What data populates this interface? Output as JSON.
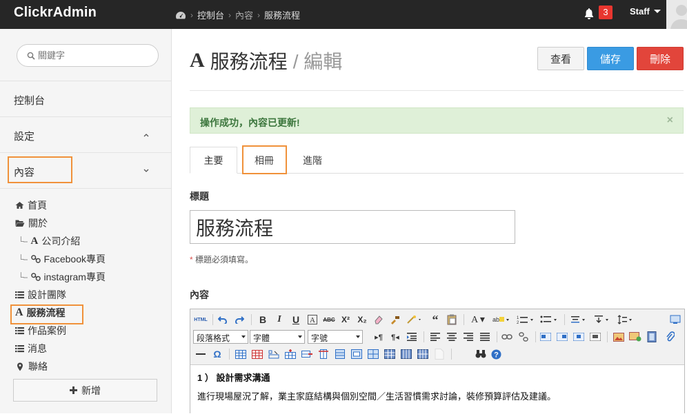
{
  "app": {
    "brand": "ClickrAdmin"
  },
  "breadcrumb": [
    "控制台",
    "內容",
    "服務流程"
  ],
  "topbar": {
    "notifications": "3",
    "user": "Staff"
  },
  "sidebar": {
    "search_placeholder": "關鍵字",
    "nav": [
      {
        "label": "控制台"
      },
      {
        "label": "設定"
      },
      {
        "label": "內容"
      }
    ],
    "tree": [
      {
        "label": "首頁",
        "icon": "home-icon"
      },
      {
        "label": "關於",
        "icon": "folder-open-icon"
      },
      {
        "label": "公司介紹",
        "icon": "font-icon"
      },
      {
        "label": "Facebook專頁",
        "icon": "link-icon"
      },
      {
        "label": "instagram專頁",
        "icon": "link-icon"
      },
      {
        "label": "設計團隊",
        "icon": "list-icon"
      },
      {
        "label": "服務流程",
        "icon": "font-icon"
      },
      {
        "label": "作品案例",
        "icon": "list-icon"
      },
      {
        "label": "消息",
        "icon": "list-icon"
      },
      {
        "label": "聯絡",
        "icon": "map-marker-icon"
      }
    ],
    "add_label": "新增"
  },
  "header": {
    "title": "服務流程",
    "subtitle": "/ 編輯",
    "buttons": {
      "view": "查看",
      "save": "儲存",
      "delete": "刪除"
    }
  },
  "alert": {
    "message": "操作成功，內容已更新!",
    "close": "×"
  },
  "tabs": [
    "主要",
    "相冊",
    "進階"
  ],
  "form": {
    "title_label": "標題",
    "title_value": "服務流程",
    "title_hint_mark": "*",
    "title_hint": " 標題必須填寫。",
    "content_label": "內容"
  },
  "editor": {
    "html_label": "HTML",
    "format_select": "段落格式",
    "font_select": "字體",
    "size_select": "字號",
    "body_heading": "1 ） 設計需求溝通",
    "body_text": "進行現場屋況了解，業主家庭結構與個別空間／生活習慣需求討論，裝修預算評估及建議。"
  },
  "colors": {
    "topbar": "#262626",
    "primary": "#3a9be3",
    "danger": "#e2453b",
    "success_bg": "#dff0d8",
    "highlight": "#f0913a"
  }
}
